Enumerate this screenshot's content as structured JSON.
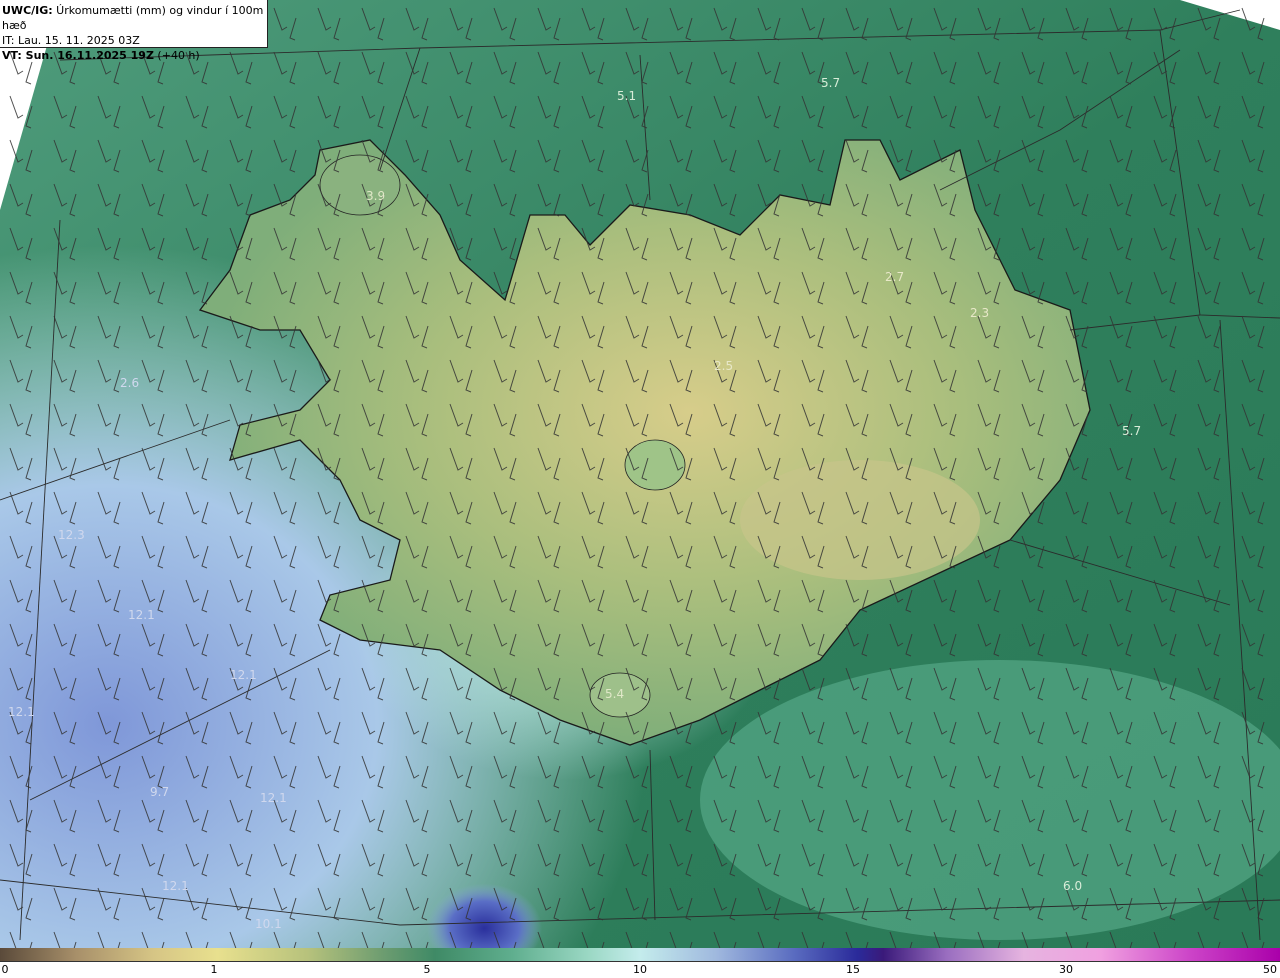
{
  "header": {
    "title_bold": "UWC/IG:",
    "title_rest": " Úrkomumætti (mm) og vindur í 100m hæð",
    "issue_time": "IT: Lau. 15. 11. 2025 03Z",
    "valid_bold": "VT: Sun. 16.11.2025 19Z",
    "valid_rest": " (+40 h)"
  },
  "map_labels": [
    {
      "id": "v-5-1",
      "text": "5.1"
    },
    {
      "id": "v-5-7-n",
      "text": "5.7"
    },
    {
      "id": "v-3-9",
      "text": "3.9"
    },
    {
      "id": "v-2-7",
      "text": "2.7"
    },
    {
      "id": "v-2-3",
      "text": "2.3"
    },
    {
      "id": "v-2-5",
      "text": "2.5"
    },
    {
      "id": "v-5-7-e",
      "text": "5.7"
    },
    {
      "id": "v-2-6",
      "text": "2.6"
    },
    {
      "id": "v-12-3",
      "text": "12.3"
    },
    {
      "id": "v-12-1-a",
      "text": "12.1"
    },
    {
      "id": "v-12-1-b",
      "text": "12.1"
    },
    {
      "id": "v-12-1-c",
      "text": "12.1"
    },
    {
      "id": "v-9-7",
      "text": "9.7"
    },
    {
      "id": "v-12-1-d",
      "text": "12.1"
    },
    {
      "id": "v-12-1-e",
      "text": "12.1"
    },
    {
      "id": "v-5-4",
      "text": "5.4"
    },
    {
      "id": "v-6-0",
      "text": "6.0"
    },
    {
      "id": "v-10-x",
      "text": "10.1"
    }
  ],
  "colorbar": {
    "ticks": [
      "0",
      "1",
      "5",
      "10",
      "15",
      "30",
      "50"
    ]
  }
}
